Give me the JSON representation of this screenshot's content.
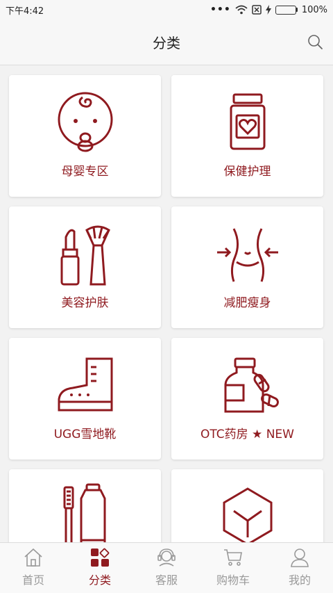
{
  "status": {
    "time": "下午4:42",
    "battery": "100%",
    "battery_level": 1.0
  },
  "header": {
    "title": "分类"
  },
  "categories": [
    {
      "label": "母婴专区",
      "icon": "baby-face-icon"
    },
    {
      "label": "保健护理",
      "icon": "supplement-jar-heart-icon"
    },
    {
      "label": "美容护肤",
      "icon": "lipstick-brush-icon"
    },
    {
      "label": "减肥瘦身",
      "icon": "slim-waist-icon"
    },
    {
      "label": "UGG雪地靴",
      "icon": "boot-icon"
    },
    {
      "label": "OTC药房 ★ NEW",
      "icon": "pill-bottle-icon"
    },
    {
      "label": "",
      "icon": "toothbrush-toothpaste-icon"
    },
    {
      "label": "",
      "icon": "box-icon"
    }
  ],
  "tabs": [
    {
      "label": "首页",
      "icon": "home-icon"
    },
    {
      "label": "分类",
      "icon": "category-grid-icon",
      "active": true
    },
    {
      "label": "客服",
      "icon": "customer-service-icon"
    },
    {
      "label": "购物车",
      "icon": "cart-icon"
    },
    {
      "label": "我的",
      "icon": "user-icon"
    }
  ],
  "colors": {
    "accent": "#8f1a1f",
    "inactive": "#999999",
    "background": "#f2f2f2",
    "card": "#ffffff"
  }
}
